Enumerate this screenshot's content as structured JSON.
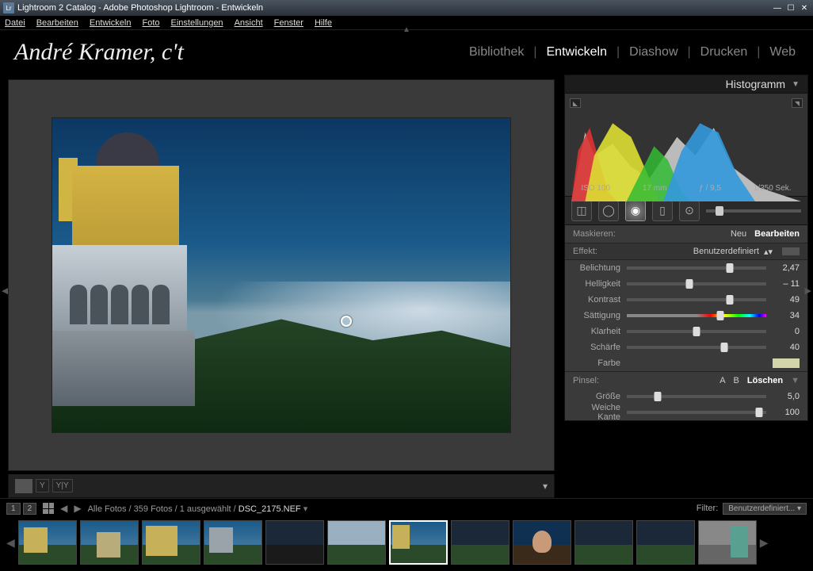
{
  "window": {
    "title": "Lightroom 2 Catalog - Adobe Photoshop Lightroom - Entwickeln",
    "app_badge": "Lr"
  },
  "menu": {
    "datei": "Datei",
    "bearbeiten": "Bearbeiten",
    "entwickeln": "Entwickeln",
    "foto": "Foto",
    "einstellungen": "Einstellungen",
    "ansicht": "Ansicht",
    "fenster": "Fenster",
    "hilfe": "Hilfe"
  },
  "identity": "André Kramer, c't",
  "modules": {
    "bibliothek": "Bibliothek",
    "entwickeln": "Entwickeln",
    "diashow": "Diashow",
    "drucken": "Drucken",
    "web": "Web"
  },
  "panels": {
    "histogram_title": "Histogramm",
    "meta": {
      "iso": "ISO 100",
      "focal": "17 mm",
      "aperture": "ƒ / 9,5",
      "shutter": "1/350 Sek."
    },
    "mask": {
      "label": "Maskieren:",
      "neu": "Neu",
      "bearbeiten": "Bearbeiten"
    },
    "effect": {
      "label": "Effekt:",
      "value": "Benutzerdefiniert"
    },
    "sliders": {
      "belichtung": {
        "label": "Belichtung",
        "value": "2,47",
        "pos": 74
      },
      "helligkeit": {
        "label": "Helligkeit",
        "value": "– 11",
        "pos": 45
      },
      "kontrast": {
        "label": "Kontrast",
        "value": "49",
        "pos": 74
      },
      "saettigung": {
        "label": "Sättigung",
        "value": "34",
        "pos": 67
      },
      "klarheit": {
        "label": "Klarheit",
        "value": "0",
        "pos": 50
      },
      "schaerfe": {
        "label": "Schärfe",
        "value": "40",
        "pos": 70
      },
      "farbe": {
        "label": "Farbe"
      }
    },
    "brush": {
      "label": "Pinsel:",
      "a": "A",
      "b": "B",
      "loeschen": "Löschen",
      "groesse": {
        "label": "Größe",
        "value": "5,0",
        "pos": 22
      },
      "kante": {
        "label": "Weiche Kante",
        "value": "100",
        "pos": 95
      }
    }
  },
  "filmstrip": {
    "mon1": "1",
    "mon2": "2",
    "crumbs_prefix": "Alle Fotos / 359 Fotos / 1 ausgewählt / ",
    "filename": "DSC_2175.NEF",
    "filter_label": "Filter:",
    "filter_value": "Benutzerdefiniert..."
  }
}
